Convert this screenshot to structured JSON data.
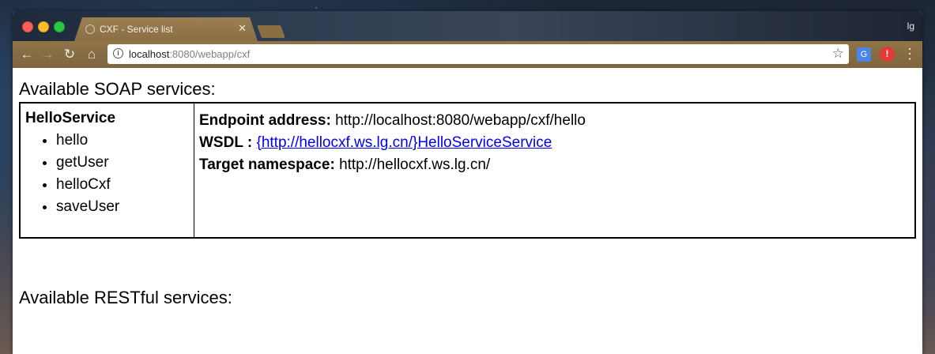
{
  "browser": {
    "tab_title": "CXF - Service list",
    "profile_name": "lg",
    "url_host": "localhost",
    "url_rest": ":8080/webapp/cxf"
  },
  "page": {
    "soap_heading": "Available SOAP services:",
    "rest_heading": "Available RESTful services:",
    "services": [
      {
        "name": "HelloService",
        "operations": [
          "hello",
          "getUser",
          "helloCxf",
          "saveUser"
        ],
        "endpoint_label": "Endpoint address:",
        "endpoint_value": "http://localhost:8080/webapp/cxf/hello",
        "wsdl_label": "WSDL :",
        "wsdl_link": "{http://hellocxf.ws.lg.cn/}HelloServiceService",
        "namespace_label": "Target namespace:",
        "namespace_value": "http://hellocxf.ws.lg.cn/"
      }
    ]
  },
  "icons": {
    "info": "i",
    "star": "☆",
    "close": "✕",
    "back": "←",
    "forward": "→",
    "reload": "↻",
    "home": "⌂",
    "menu": "⋮"
  }
}
